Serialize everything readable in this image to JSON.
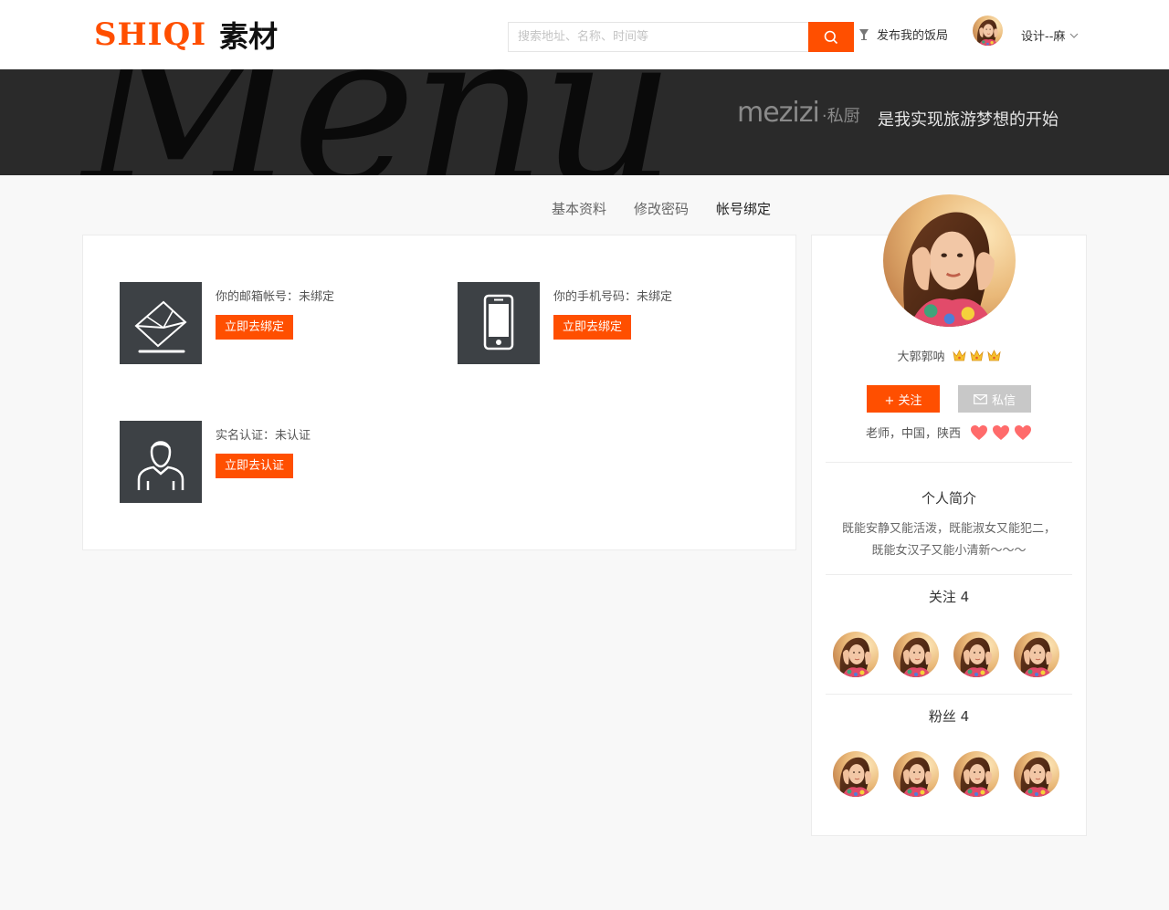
{
  "header": {
    "logo_en": "SHIQI",
    "logo_cn": "素材",
    "search_placeholder": "搜索地址、名称、时间等",
    "publish_label": "发布我的饭局",
    "user_label": "设计--麻"
  },
  "banner": {
    "script_text": "Menu",
    "brand_en": "mezizi",
    "brand_cn": "·私厨",
    "slogan": "是我实现旅游梦想的开始"
  },
  "tabs": [
    {
      "label": "基本资料"
    },
    {
      "label": "修改密码"
    },
    {
      "label": "帐号绑定"
    }
  ],
  "bindings": {
    "email": {
      "text": "你的邮箱帐号：未绑定",
      "button": "立即去绑定"
    },
    "phone": {
      "text": "你的手机号码：未绑定",
      "button": "立即去绑定"
    },
    "realname": {
      "text": "实名认证：未认证",
      "button": "立即去认证"
    }
  },
  "profile": {
    "name": "大郭郭呐",
    "follow_button": "+ 关注",
    "message_button": "私信",
    "meta": "老师，中国，陕西",
    "bio_title": "个人简介",
    "bio_line1": "既能安静又能活泼，既能淑女又能犯二，",
    "bio_line2": "既能女汉子又能小清新～～～",
    "following_title": "关注 4",
    "fans_title": "粉丝 4"
  },
  "colors": {
    "accent": "#ff4f00",
    "banner_bg": "#2a2a2a",
    "icon_tile": "#3d4145"
  }
}
